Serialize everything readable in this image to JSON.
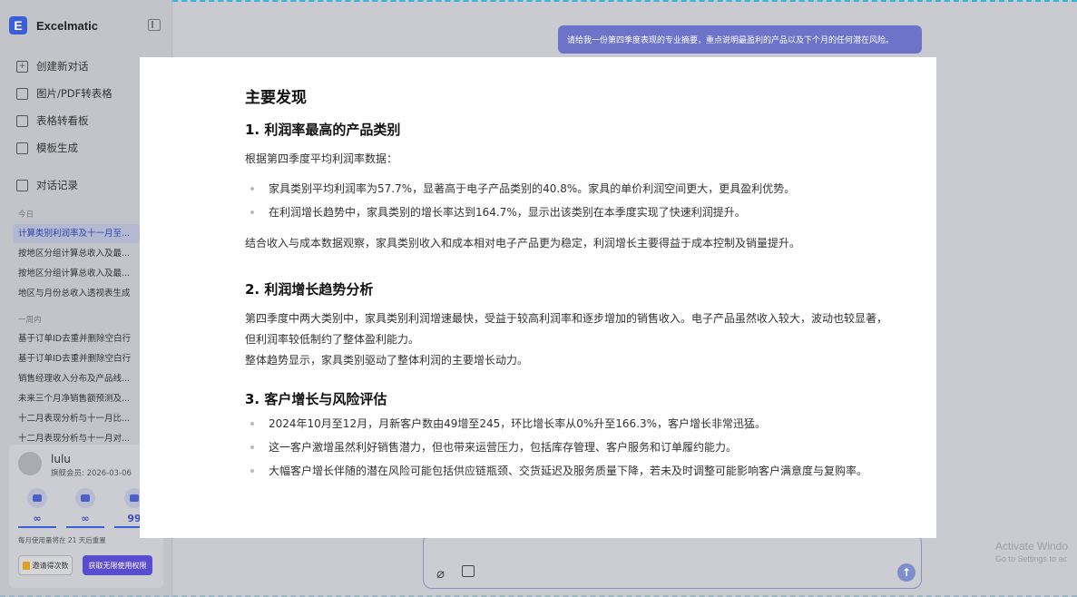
{
  "app": {
    "name": "Excelmatic"
  },
  "sidebar": {
    "menu": [
      {
        "label": "创建新对话",
        "icon": "plus-square-icon"
      },
      {
        "label": "图片/PDF转表格",
        "icon": "image-icon"
      },
      {
        "label": "表格转看板",
        "icon": "dashboard-icon"
      },
      {
        "label": "模板生成",
        "icon": "template-icon"
      }
    ],
    "history_label": "对话记录",
    "groups": [
      {
        "label": "今日",
        "items": [
          "计算类别利润率及十一月至...",
          "按地区分组计算总收入及最...",
          "按地区分组计算总收入及最...",
          "地区与月份总收入透视表生成"
        ]
      },
      {
        "label": "一周内",
        "items": [
          "基于订单ID去重并删除空白行",
          "基于订单ID去重并删除空白行",
          "销售经理收入分布及产品线...",
          "未来三个月净销售额预测及...",
          "十二月表现分析与十一月比...",
          "十二月表现分析与十一月对..."
        ]
      }
    ]
  },
  "user": {
    "name": "lulu",
    "membership": "旗舰会员: 2026-03-06",
    "stats": [
      "∞",
      "∞",
      "99"
    ],
    "usage_note": "每月使用量将在 21 天后重置",
    "invite_label": "邀请得次数",
    "upgrade_label": "获取无限使用权限"
  },
  "chat": {
    "user_message": "请给我一份第四季度表现的专业摘要，重点说明最盈利的产品以及下个月的任何潜在风险。"
  },
  "watermark": {
    "line1": "Activate Windo",
    "line2": "Go to Settings to ac"
  },
  "report": {
    "title": "主要发现",
    "s1": {
      "heading": "1. 利润率最高的产品类别",
      "intro": "根据第四季度平均利润率数据：",
      "bullets": [
        "家具类别平均利润率为57.7%，显著高于电子产品类别的40.8%。家具的单价利润空间更大，更具盈利优势。",
        "在利润增长趋势中，家具类别的增长率达到164.7%，显示出该类别在本季度实现了快速利润提升。"
      ],
      "outro": "结合收入与成本数据观察，家具类别收入和成本相对电子产品更为稳定，利润增长主要得益于成本控制及销量提升。"
    },
    "s2": {
      "heading": "2. 利润增长趋势分析",
      "p1": "第四季度中两大类别中，家具类别利润增速最快，受益于较高利润率和逐步增加的销售收入。电子产品虽然收入较大，波动也较显著，但利润率较低制约了整体盈利能力。",
      "p2": "整体趋势显示，家具类别驱动了整体利润的主要增长动力。"
    },
    "s3": {
      "heading": "3. 客户增长与风险评估",
      "bullets": [
        "2024年10月至12月，月新客户数由49增至245，环比增长率从0%升至166.3%，客户增长非常迅猛。",
        "这一客户激增虽然利好销售潜力，但也带来运营压力，包括库存管理、客户服务和订单履约能力。",
        "大幅客户增长伴随的潜在风险可能包括供应链瓶颈、交货延迟及服务质量下降，若未及时调整可能影响客户满意度与复购率。"
      ]
    }
  }
}
